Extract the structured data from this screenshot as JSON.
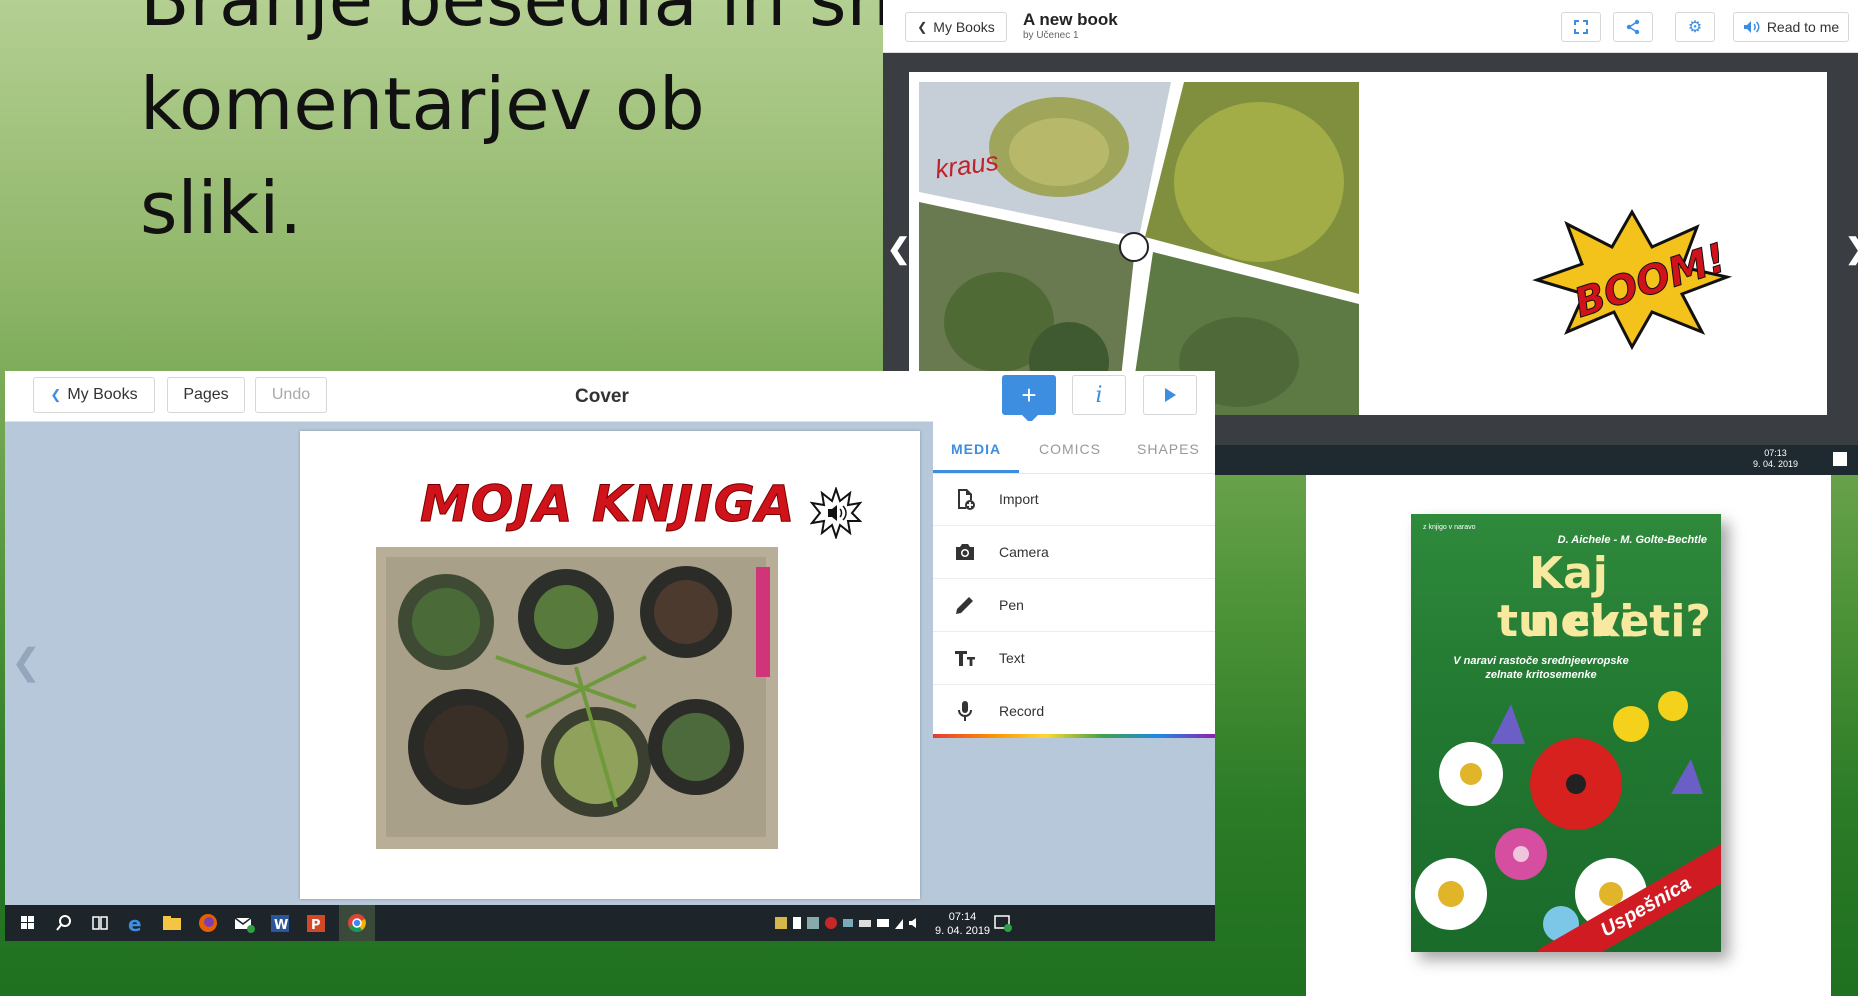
{
  "slide": {
    "title_line1": "Branje besedila in snemanje komentarjev ob",
    "title_line2": "sliki."
  },
  "reader": {
    "back_label": "My Books",
    "book_title": "A new book",
    "book_author": "by Učenec 1",
    "read_to_me_label": "Read to me",
    "photo_label": "kraus",
    "boom_text": "BOOM!",
    "clock_time": "07:13",
    "clock_date": "9. 04. 2019"
  },
  "editor": {
    "back_label": "My Books",
    "pages_label": "Pages",
    "undo_label": "Undo",
    "page_title": "Cover",
    "add_label": "+",
    "info_label": "i",
    "page_heading": "MOJA KNJIGA",
    "tabs": [
      {
        "label": "MEDIA"
      },
      {
        "label": "COMICS"
      },
      {
        "label": "SHAPES"
      }
    ],
    "menu": [
      {
        "label": "Import",
        "icon": "import-icon"
      },
      {
        "label": "Camera",
        "icon": "camera-icon"
      },
      {
        "label": "Pen",
        "icon": "pen-icon"
      },
      {
        "label": "Text",
        "icon": "text-icon"
      },
      {
        "label": "Record",
        "icon": "microphone-icon"
      }
    ],
    "taskbar": {
      "clock_time": "07:14",
      "clock_date": "9. 04. 2019"
    }
  },
  "book_cover": {
    "series": "z knjigo v naravo",
    "authors": "D. Aichele - M. Golte-Bechtle",
    "title_line1": "Kaj neki",
    "title_line2": "tu cveti?",
    "subtitle": "V naravi rastoče srednjeevropske zelnate kritosemenke",
    "ribbon": "Uspešnica"
  },
  "colors": {
    "accent_blue": "#3d8de0",
    "heading_red": "#d0121a",
    "book_green": "#237a32"
  }
}
